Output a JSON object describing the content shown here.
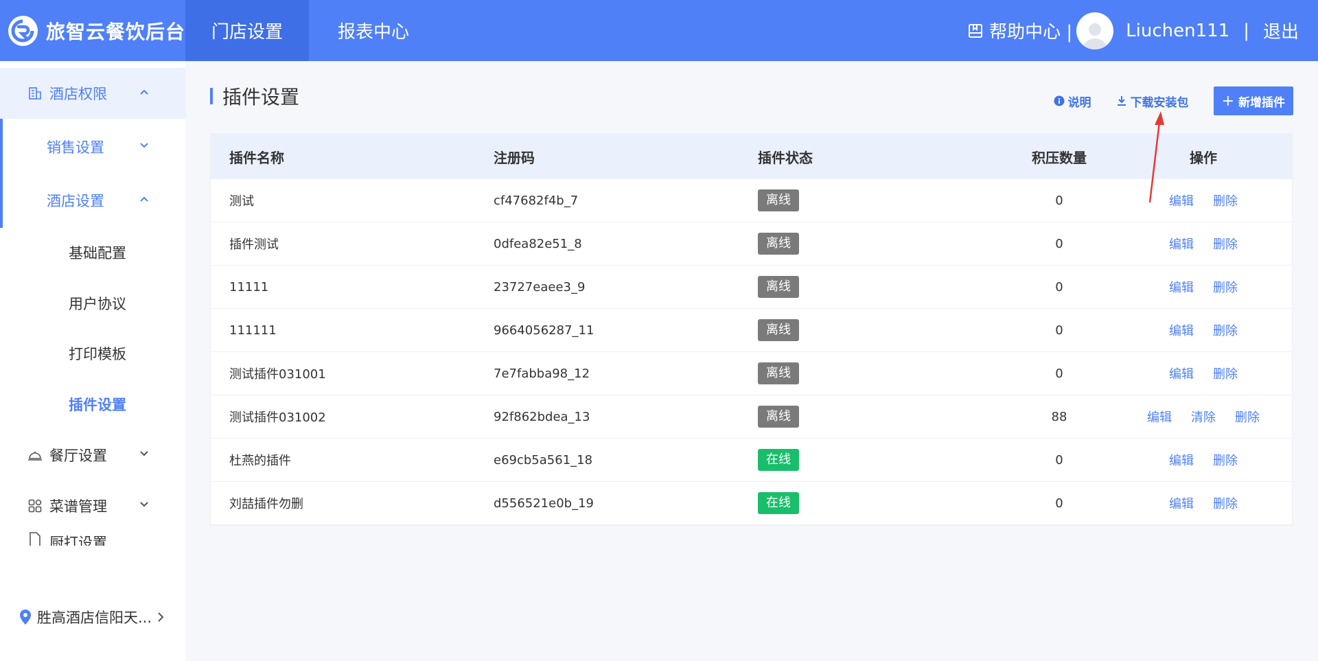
{
  "header": {
    "logo_text": "旅智云餐饮后台",
    "tabs": [
      {
        "label": "门店设置",
        "active": true
      },
      {
        "label": "报表中心",
        "active": false
      }
    ],
    "help_label": "帮助中心 |",
    "username": "Liuchen111",
    "divider": "|",
    "logout_label": "退出"
  },
  "sidebar": {
    "hotel_rights": "酒店权限",
    "sales_settings": "销售设置",
    "hotel_settings": "酒店设置",
    "basic_config": "基础配置",
    "user_agreement": "用户协议",
    "print_template": "打印模板",
    "plugin_settings": "插件设置",
    "restaurant_settings": "餐厅设置",
    "menu_management": "菜谱管理",
    "kitchen_print": "厨打设置",
    "hotel_name": "胜高酒店信阳天..."
  },
  "main": {
    "title": "插件设置",
    "explain_label": "说明",
    "download_label": "下载安装包",
    "add_label": "新增插件",
    "columns": [
      "插件名称",
      "注册码",
      "插件状态",
      "积压数量",
      "操作"
    ],
    "rows": [
      {
        "name": "测试",
        "code": "cf47682f4b_7",
        "status": "离线",
        "backlog": "0",
        "ops": [
          "编辑",
          "删除"
        ]
      },
      {
        "name": "插件测试",
        "code": "0dfea82e51_8",
        "status": "离线",
        "backlog": "0",
        "ops": [
          "编辑",
          "删除"
        ]
      },
      {
        "name": "11111",
        "code": "23727eaee3_9",
        "status": "离线",
        "backlog": "0",
        "ops": [
          "编辑",
          "删除"
        ]
      },
      {
        "name": "111111",
        "code": "9664056287_11",
        "status": "离线",
        "backlog": "0",
        "ops": [
          "编辑",
          "删除"
        ]
      },
      {
        "name": "测试插件031001",
        "code": "7e7fabba98_12",
        "status": "离线",
        "backlog": "0",
        "ops": [
          "编辑",
          "删除"
        ]
      },
      {
        "name": "测试插件031002",
        "code": "92f862bdea_13",
        "status": "离线",
        "backlog": "88",
        "ops": [
          "编辑",
          "清除",
          "删除"
        ]
      },
      {
        "name": "杜燕的插件",
        "code": "e69cb5a561_18",
        "status": "在线",
        "backlog": "0",
        "ops": [
          "编辑",
          "删除"
        ]
      },
      {
        "name": "刘喆插件勿删",
        "code": "d556521e0b_19",
        "status": "在线",
        "backlog": "0",
        "ops": [
          "编辑",
          "删除"
        ]
      }
    ]
  },
  "colors": {
    "primary": "#4f80f7",
    "offline": "#7a7a7a",
    "online": "#19be6b",
    "annotation": "#e53935"
  }
}
